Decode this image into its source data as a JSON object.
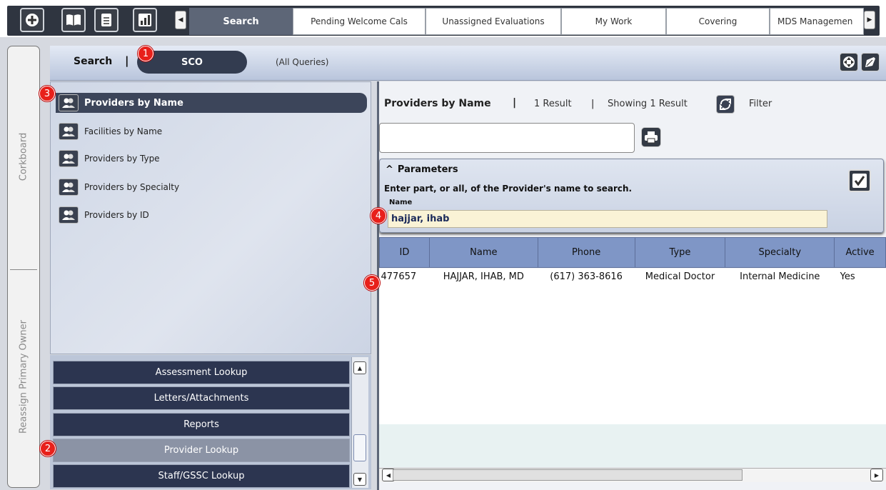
{
  "topbar": {
    "icons": [
      "add-icon",
      "book-icon",
      "document-icon",
      "bar-chart-icon"
    ],
    "tabs": [
      {
        "label": "Search",
        "active": true
      },
      {
        "label": "Pending Welcome Cals"
      },
      {
        "label": "Unassigned Evaluations"
      },
      {
        "label": "My Work"
      },
      {
        "label": "Covering"
      },
      {
        "label": "MDS Managemen"
      }
    ]
  },
  "side_strip": {
    "top_label": "Corkboard",
    "bottom_label": "Reassign Primary Owner"
  },
  "titlebar": {
    "search_label": "Search",
    "separator": "|",
    "scope": "SCO",
    "scope_hint": "(All Queries)"
  },
  "queries": [
    {
      "label": "Providers by Name",
      "selected": true
    },
    {
      "label": "Facilities by Name"
    },
    {
      "label": "Providers by Type"
    },
    {
      "label": "Providers by Specialty"
    },
    {
      "label": "Providers by ID"
    }
  ],
  "nav_buttons": [
    {
      "label": "Assessment Lookup"
    },
    {
      "label": "Letters/Attachments"
    },
    {
      "label": "Reports"
    },
    {
      "label": "Provider Lookup",
      "selected": true
    },
    {
      "label": "Staff/GSSC Lookup"
    }
  ],
  "results": {
    "title": "Providers by Name",
    "separator": "|",
    "count": "1 Result",
    "showing": "Showing 1 Result",
    "filter_label": "Filter",
    "filter_value": ""
  },
  "parameters": {
    "heading": "Parameters",
    "description": "Enter part, or all, of the Provider's name to search.",
    "name_label": "Name",
    "name_value": "hajjar, ihab"
  },
  "table": {
    "columns": [
      "ID",
      "Name",
      "Phone",
      "Type",
      "Specialty",
      "Active"
    ],
    "rows": [
      [
        "477657",
        "HAJJAR, IHAB, MD",
        "(617) 363-8616",
        "Medical Doctor",
        "Internal Medicine",
        "Yes"
      ]
    ]
  },
  "callouts": [
    "1",
    "2",
    "3",
    "4",
    "5"
  ],
  "colors": {
    "callout": "#e8201a",
    "header": "#7f96c6",
    "dark": "#2c3550"
  }
}
